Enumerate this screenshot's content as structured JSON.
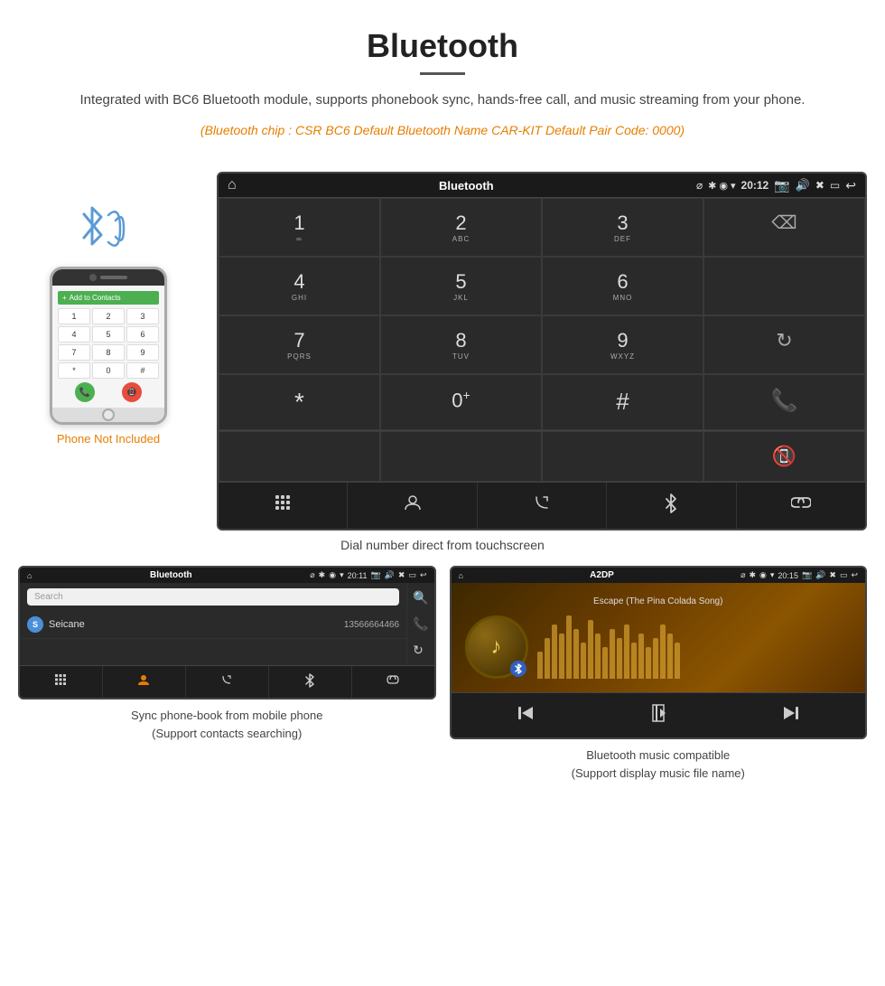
{
  "header": {
    "title": "Bluetooth",
    "description": "Integrated with BC6 Bluetooth module, supports phonebook sync, hands-free call, and music streaming from your phone.",
    "specs": "(Bluetooth chip : CSR BC6    Default Bluetooth Name CAR-KIT    Default Pair Code: 0000)"
  },
  "car_unit": {
    "status_bar": {
      "title": "Bluetooth",
      "time": "20:12",
      "usb_symbol": "⌀"
    },
    "dialpad": [
      {
        "num": "1",
        "sub": "∞"
      },
      {
        "num": "2",
        "sub": "ABC"
      },
      {
        "num": "3",
        "sub": "DEF"
      },
      {
        "num": "",
        "sub": ""
      },
      {
        "num": "4",
        "sub": "GHI"
      },
      {
        "num": "5",
        "sub": "JKL"
      },
      {
        "num": "6",
        "sub": "MNO"
      },
      {
        "num": "",
        "sub": ""
      },
      {
        "num": "7",
        "sub": "PQRS"
      },
      {
        "num": "8",
        "sub": "TUV"
      },
      {
        "num": "9",
        "sub": "WXYZ"
      },
      {
        "num": "",
        "sub": "reload"
      },
      {
        "num": "*",
        "sub": ""
      },
      {
        "num": "0",
        "sub": "+"
      },
      {
        "num": "#",
        "sub": ""
      },
      {
        "num": "",
        "sub": ""
      }
    ],
    "toolbar": [
      "⊞",
      "👤",
      "📞",
      "✱",
      "🔗"
    ]
  },
  "caption": "Dial number direct from touchscreen",
  "phone_not_included": "Phone Not Included",
  "phonebook": {
    "status": {
      "title": "Bluetooth",
      "time": "20:11"
    },
    "search_placeholder": "Search",
    "contact": {
      "letter": "S",
      "name": "Seicane",
      "number": "13566664466"
    }
  },
  "music": {
    "status": {
      "title": "A2DP",
      "time": "20:15"
    },
    "song_title": "Escape (The Pina Colada Song)"
  },
  "panel_captions": {
    "phonebook": "Sync phone-book from mobile phone\n(Support contacts searching)",
    "music": "Bluetooth music compatible\n(Support display music file name)"
  },
  "eq_bars": [
    30,
    45,
    60,
    50,
    70,
    55,
    40,
    65,
    50,
    35,
    55,
    45,
    60,
    40,
    50,
    35,
    45,
    60,
    50,
    40
  ]
}
